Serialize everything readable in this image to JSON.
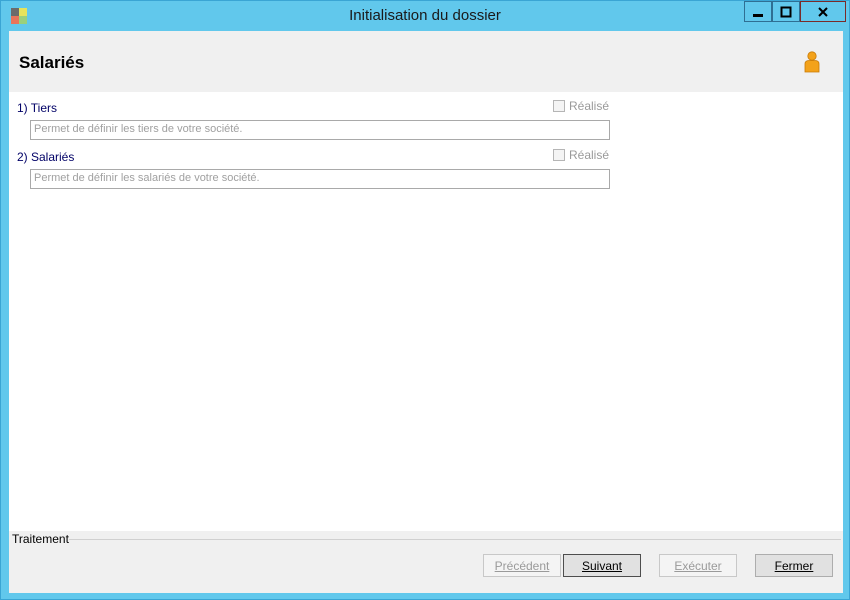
{
  "window": {
    "title": "Initialisation du dossier",
    "controls": {
      "minimize": "—",
      "maximize": "□",
      "close": "X"
    }
  },
  "header": {
    "title": "Salariés"
  },
  "items": [
    {
      "label": "1) Tiers",
      "done_label": "Réalisé",
      "description": "Permet de définir les tiers de votre société."
    },
    {
      "label": "2) Salariés",
      "done_label": "Réalisé",
      "description": "Permet de définir les salariés de votre société."
    }
  ],
  "footer": {
    "group_label": "Traitement",
    "buttons": {
      "previous": "Précédent",
      "next": "Suivant",
      "execute": "Exécuter",
      "close": "Fermer"
    }
  },
  "icons": [
    "app-icon",
    "minimize-icon",
    "maximize-icon",
    "close-icon",
    "user-icon"
  ]
}
